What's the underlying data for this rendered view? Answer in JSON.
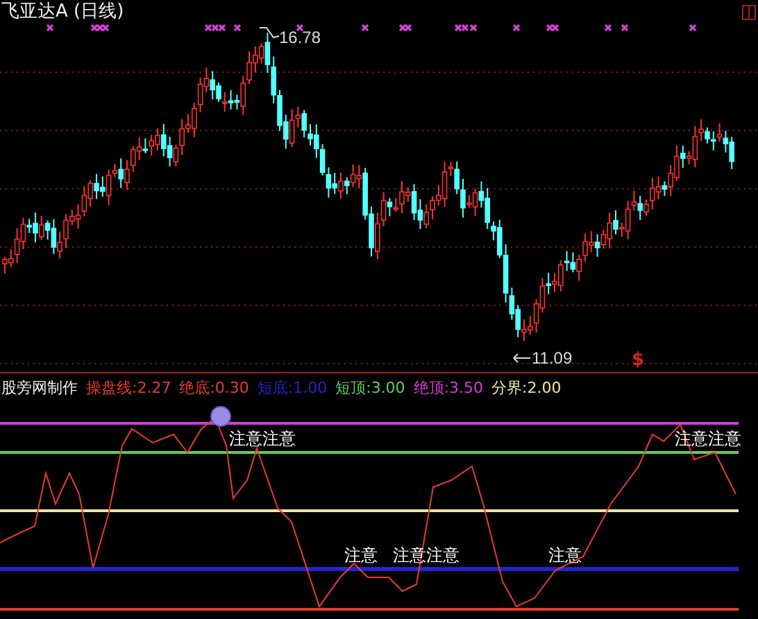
{
  "chart": {
    "title": "飞亚达A (日线)",
    "high_label": "16.78",
    "low_label": "11.09",
    "sell_signal": "$"
  },
  "indicator": {
    "name": "股旁网制作",
    "params": [
      {
        "label": "操盘线:2.27",
        "color": "#e83a2e"
      },
      {
        "label": "绝底:0.30",
        "color": "#e83a2e"
      },
      {
        "label": "短底:1.00",
        "color": "#2424c8"
      },
      {
        "label": "短顶:3.00",
        "color": "#5ccf5c"
      },
      {
        "label": "绝顶:3.50",
        "color": "#d838d8"
      },
      {
        "label": "分界:2.00",
        "color": "#f0e8a0"
      }
    ],
    "alerts": [
      {
        "text": "注意注意",
        "kind": "top"
      },
      {
        "text": "注意注意",
        "kind": "top"
      },
      {
        "text": "注意",
        "kind": "bottom"
      },
      {
        "text": "注意注意",
        "kind": "bottom"
      },
      {
        "text": "注意",
        "kind": "bottom"
      }
    ]
  }
}
